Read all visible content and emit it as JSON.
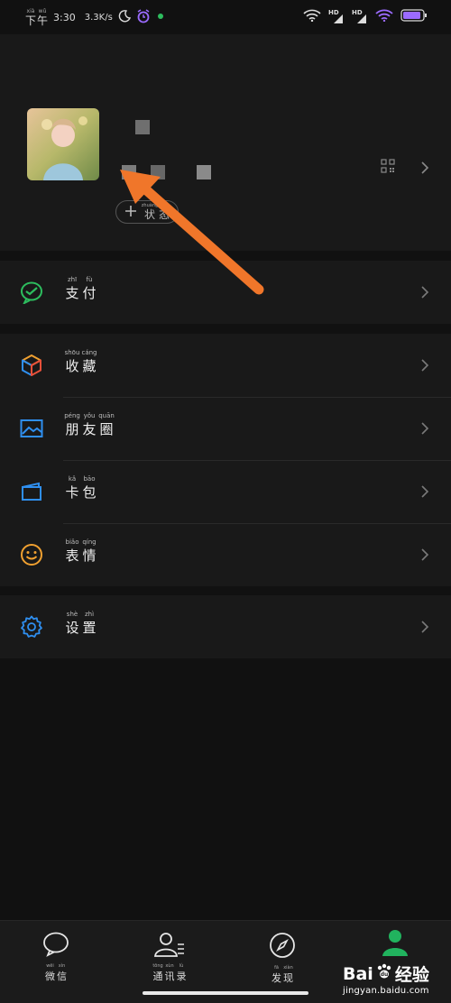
{
  "status_bar": {
    "time_py": [
      "xià",
      "wǔ"
    ],
    "time_hz": [
      "下",
      "午"
    ],
    "time": "3:30",
    "net_speed": "3.3K/s",
    "hd1": "HD",
    "hd2": "HD"
  },
  "profile": {
    "status_button_py": [
      "zhuàng",
      "tài"
    ],
    "status_button_hz": [
      "状",
      "态"
    ]
  },
  "menu": {
    "pay": {
      "py": [
        "zhī",
        "fù"
      ],
      "hz": [
        "支",
        "付"
      ]
    },
    "favorites": {
      "py": [
        "shōu",
        "cáng"
      ],
      "hz": [
        "收",
        "藏"
      ]
    },
    "moments": {
      "py": [
        "péng",
        "yǒu",
        "quān"
      ],
      "hz": [
        "朋",
        "友",
        "圈"
      ]
    },
    "cards": {
      "py": [
        "kǎ",
        "bāo"
      ],
      "hz": [
        "卡",
        "包"
      ]
    },
    "stickers": {
      "py": [
        "biǎo",
        "qíng"
      ],
      "hz": [
        "表",
        "情"
      ]
    },
    "settings": {
      "py": [
        "shè",
        "zhì"
      ],
      "hz": [
        "设",
        "置"
      ]
    }
  },
  "tabbar": {
    "chats": {
      "py": [
        "wēi",
        "xìn"
      ],
      "hz": [
        "微",
        "信"
      ]
    },
    "contacts": {
      "py": [
        "tōng",
        "xùn",
        "lù"
      ],
      "hz": [
        "通",
        "讯",
        "录"
      ]
    },
    "discover": {
      "py": [
        "fā",
        "xiàn"
      ],
      "hz": [
        "发",
        "现"
      ]
    }
  },
  "watermark": {
    "brand": "Bai",
    "brand_suffix": "经验",
    "url": "jingyan.baidu.com"
  },
  "colors": {
    "pay_green": "#2dbd5e",
    "settings_blue": "#2f8ff0",
    "moments_blue": "#2f8ff0",
    "stickers_orange": "#f0a030",
    "arrow_orange": "#f0762a",
    "me_tab_green": "#21b35e"
  }
}
